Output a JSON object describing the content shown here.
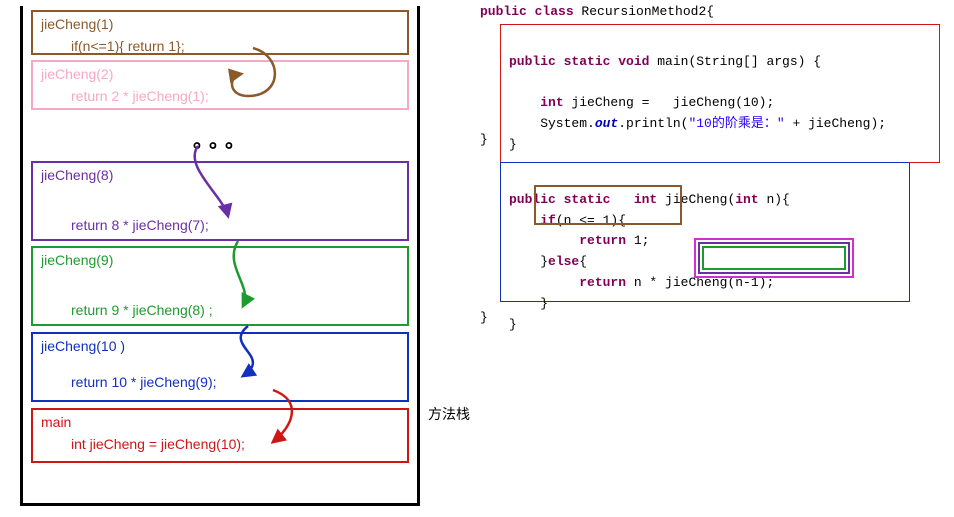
{
  "stack": {
    "label": "方法栈",
    "ellipsis": "。。。",
    "frames": [
      {
        "id": "f1",
        "title": "jieCheng(1)",
        "body": "if(n<=1){  return 1};",
        "color": "#8b5a2b"
      },
      {
        "id": "f2",
        "title": "jieCheng(2)",
        "body": "return  2 * jieCheng(1);",
        "color": "#f7a8c4"
      },
      {
        "id": "f8",
        "title": "jieCheng(8)",
        "body": "return 8 * jieCheng(7);",
        "color": "#6a2fa5"
      },
      {
        "id": "f9",
        "title": "jieCheng(9)",
        "body": "return 9 * jieCheng(8) ;",
        "color": "#1e9b2e"
      },
      {
        "id": "f10",
        "title": "jieCheng(10 )",
        "body": "return 10 * jieCheng(9);",
        "color": "#1030c0"
      },
      {
        "id": "main",
        "title": "main",
        "body": "int jieCheng =   jieCheng(10);",
        "color": "#d01515"
      }
    ]
  },
  "code": {
    "class_decl": "public class RecursionMethod2{",
    "main_sig": "public static void main(String[] args) {",
    "int_decl": "int jieCheng =   jieCheng(10);",
    "println_pre": "System.",
    "println_out": "out",
    "println_post": ".println(",
    "println_str": "\"10的阶乘是：\"",
    "println_tail": " + jieCheng);",
    "close1": "}",
    "close2": "}",
    "method_sig": "public static   int jieCheng(int n){",
    "if_line": "if(n <= 1){",
    "return1": "return 1;",
    "else_line": "}else{",
    "return_rec": "return n * ",
    "rec_call": "jieCheng(n-1)",
    "semicolon": ";",
    "close3": "}",
    "close4": "}",
    "close5": "}"
  },
  "colors": {
    "brown": "#8b5a2b",
    "pink": "#f7a8c4",
    "purple": "#6a2fa5",
    "green": "#1e9b2e",
    "blue": "#1030c0",
    "red": "#d01515",
    "magenta": "#d030d0"
  }
}
